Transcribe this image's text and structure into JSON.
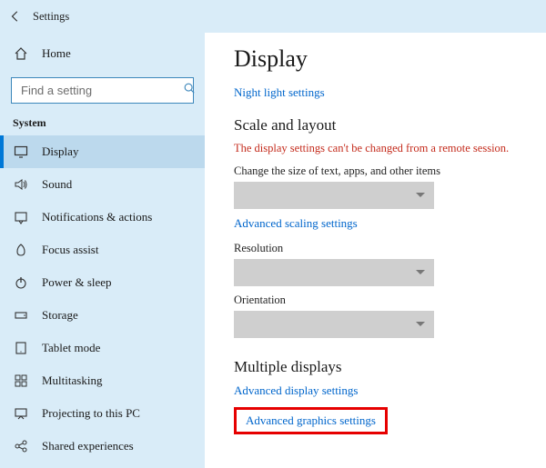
{
  "window": {
    "title": "Settings"
  },
  "sidebar": {
    "home_label": "Home",
    "search_placeholder": "Find a setting",
    "section_label": "System",
    "items": [
      {
        "label": "Display",
        "icon": "monitor",
        "active": true
      },
      {
        "label": "Sound",
        "icon": "sound"
      },
      {
        "label": "Notifications & actions",
        "icon": "notifications"
      },
      {
        "label": "Focus assist",
        "icon": "focus"
      },
      {
        "label": "Power & sleep",
        "icon": "power"
      },
      {
        "label": "Storage",
        "icon": "storage"
      },
      {
        "label": "Tablet mode",
        "icon": "tablet"
      },
      {
        "label": "Multitasking",
        "icon": "multitask"
      },
      {
        "label": "Projecting to this PC",
        "icon": "project"
      },
      {
        "label": "Shared experiences",
        "icon": "share"
      }
    ]
  },
  "content": {
    "title": "Display",
    "night_light_link": "Night light settings",
    "scale_heading": "Scale and layout",
    "warning": "The display settings can't be changed from a remote session.",
    "scale_label": "Change the size of text, apps, and other items",
    "advanced_scaling_link": "Advanced scaling settings",
    "resolution_label": "Resolution",
    "orientation_label": "Orientation",
    "multiple_heading": "Multiple displays",
    "advanced_display_link": "Advanced display settings",
    "advanced_graphics_link": "Advanced graphics settings"
  }
}
